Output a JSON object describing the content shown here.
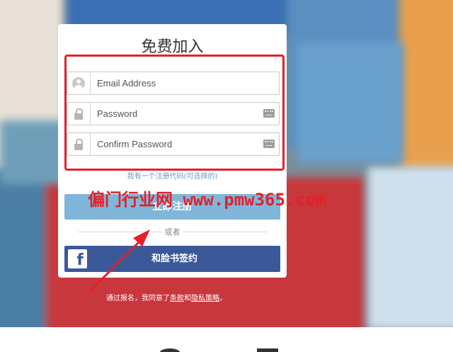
{
  "signup": {
    "title": "免费加入",
    "email_placeholder": "Email Address",
    "password_placeholder": "Password",
    "confirm_placeholder": "Confirm Password",
    "invite_link": "我有一个注册代码(可选择的)",
    "signup_button": "立即注册",
    "or_divider": "或者",
    "facebook_button": "和脸书签约",
    "facebook_glyph": "f"
  },
  "terms": {
    "prefix": "通过报名，我同意了",
    "terms_link": "条款",
    "and": "和",
    "privacy_link": "隐私策略",
    "suffix": "。"
  },
  "watermark": "偏门行业网 www.pmw365.com",
  "colors": {
    "highlight_red": "#e4202a",
    "signup_button": "#7fb6da",
    "facebook_blue": "#3b5998"
  },
  "icons": {
    "email": "avatar-icon",
    "password": "lock-icon",
    "keyboard": "keyboard-icon"
  }
}
